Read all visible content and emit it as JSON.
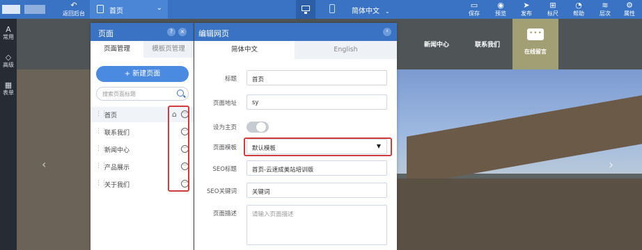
{
  "topbar": {
    "back_label": "返回后台",
    "page_selector": "首页",
    "language_selector": "简体中文",
    "buttons": [
      {
        "label": "保存",
        "icon": "save-icon"
      },
      {
        "label": "预览",
        "icon": "eye-icon"
      },
      {
        "label": "发布",
        "icon": "send-icon"
      },
      {
        "label": "标尺",
        "icon": "ruler-icon"
      },
      {
        "label": "帮助",
        "icon": "help-icon"
      },
      {
        "label": "层次",
        "icon": "layers-icon"
      },
      {
        "label": "属性",
        "icon": "gear-icon"
      }
    ]
  },
  "rail": {
    "items": [
      {
        "label": "常用",
        "icon": "A"
      },
      {
        "label": "高级",
        "icon": "◇"
      },
      {
        "label": "表单",
        "icon": "▦"
      }
    ]
  },
  "preview": {
    "nav": [
      "新闻中心",
      "联系我们"
    ],
    "message_label": "在线留言"
  },
  "pages_panel": {
    "title": "页面",
    "help": "?",
    "close": "×",
    "tabs": [
      "页面管理",
      "模板页管理"
    ],
    "new_page": "+ 新建页面",
    "search_placeholder": "搜索页面标题",
    "pages": [
      "首页",
      "联系我们",
      "新闻中心",
      "产品展示",
      "关于我们"
    ]
  },
  "edit_panel": {
    "title": "编辑网页",
    "lang_tabs": [
      "简体中文",
      "English"
    ],
    "fields": {
      "title_label": "标题",
      "title_value": "首页",
      "url_label": "页面地址",
      "url_value": "sy",
      "home_label": "设为主页",
      "template_label": "页面模板",
      "template_value": "默认模板",
      "seo_title_label": "SEO标题",
      "seo_title_value": "首页-云速成美站培训版",
      "seo_kw_label": "SEO关键词",
      "seo_kw_value": "关键词",
      "desc_label": "页面描述",
      "desc_placeholder": "请输入页面描述"
    }
  }
}
